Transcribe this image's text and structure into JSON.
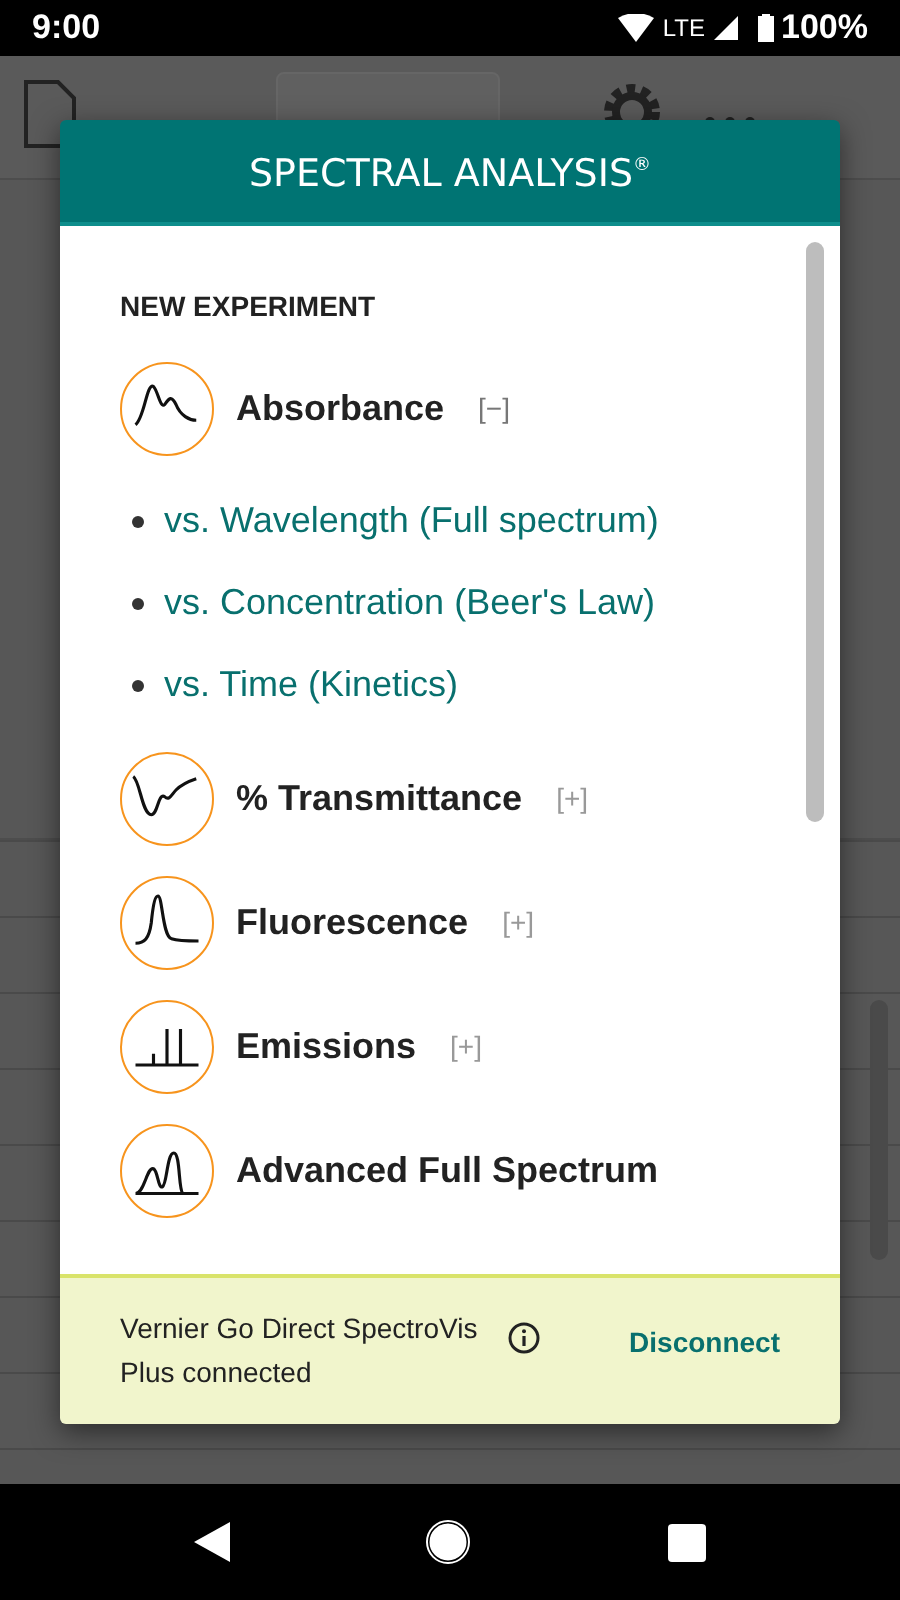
{
  "status_bar": {
    "time": "9:00",
    "network": "LTE",
    "battery": "100%"
  },
  "dialog": {
    "title": "SPECTRAL ANALYSIS$^{®}$",
    "section_heading": "NEW EXPERIMENT",
    "experiments": [
      {
        "kind": "absorbance",
        "label": "Absorbance",
        "toggle": "[−]",
        "expanded": true,
        "options": [
          "vs. Wavelength (Full spectrum)",
          "vs. Concentration (Beer's Law)",
          "vs. Time (Kinetics)"
        ]
      },
      {
        "kind": "transmittance",
        "label": "% Transmittance",
        "toggle": "[+]",
        "expanded": false
      },
      {
        "kind": "fluorescence",
        "label": "Fluorescence",
        "toggle": "[+]",
        "expanded": false
      },
      {
        "kind": "emissions",
        "label": "Emissions",
        "toggle": "[+]",
        "expanded": false
      },
      {
        "kind": "advanced",
        "label": "Advanced Full Spectrum"
      }
    ],
    "connection": {
      "message": "Vernier Go Direct SpectroVis Plus connected",
      "action": "Disconnect"
    }
  }
}
